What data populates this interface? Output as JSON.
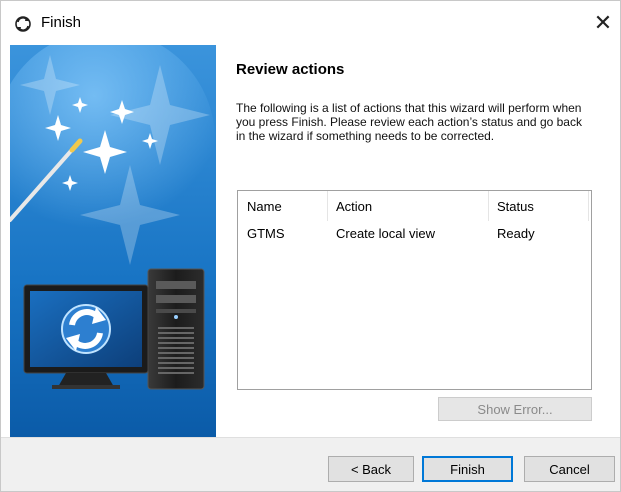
{
  "window": {
    "title": "Finish",
    "close_glyph": "✕"
  },
  "icons": {
    "title": "wizard-finish-icon",
    "close": "close-icon"
  },
  "page": {
    "heading": "Review actions",
    "description": "The following is a list of actions that this wizard will perform when you press Finish. Please review each action’s status and go back in the wizard if something needs to be corrected."
  },
  "table": {
    "columns": [
      "Name",
      "Action",
      "Status"
    ],
    "rows": [
      {
        "name": "GTMS",
        "action": "Create local view",
        "status": "Ready"
      }
    ]
  },
  "buttons": {
    "show_error": "Show Error...",
    "back": "< Back",
    "finish": "Finish",
    "cancel": "Cancel"
  },
  "colors": {
    "accent": "#0078d7",
    "panel_blue": "#1d7fce",
    "panel_blue_dark": "#0b4f93"
  }
}
